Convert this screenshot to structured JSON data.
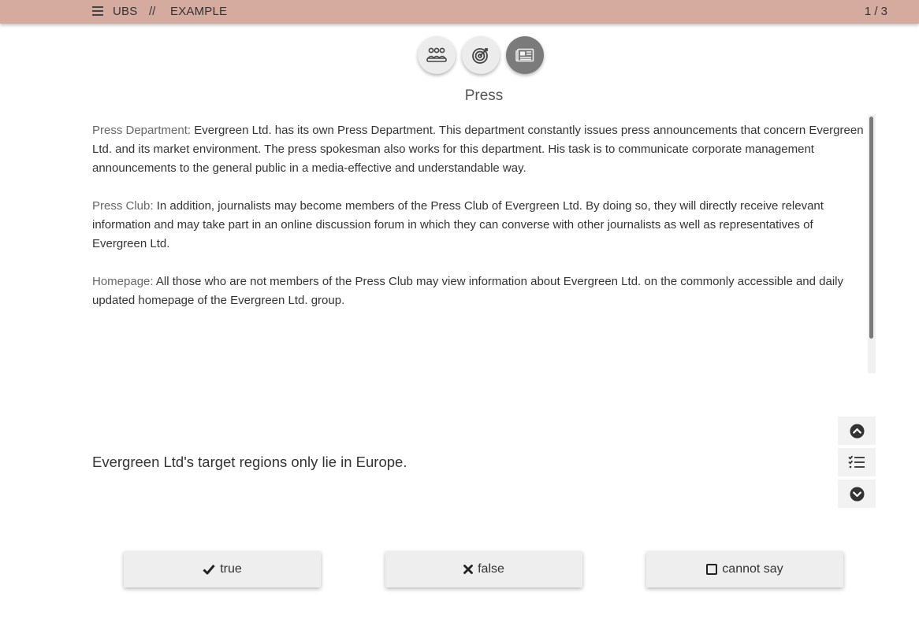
{
  "header": {
    "brand": "UBS",
    "separator": "//",
    "crumb": "EXAMPLE",
    "pager": "1 / 3"
  },
  "tabs": [
    {
      "icon": "team-icon"
    },
    {
      "icon": "target-icon"
    },
    {
      "icon": "newspaper-icon",
      "active": true
    }
  ],
  "section": {
    "title": "Press",
    "paragraphs": [
      {
        "term": "Press Department:",
        "text": " Evergreen Ltd. has its own Press Department. This department constantly issues press announcements that concern Evergreen Ltd. and its market environment. The press spokesman also works for this department. His task is to communicate corporate management announcements to the general public in a media-effective and understandable way."
      },
      {
        "term": "Press Club:",
        "text": " In addition, journalists may become members of the Press Club of Evergreen Ltd. By doing so, they will directly receive relevant information and may take part in an online discussion forum in which they can converse with other journalists as well as representatives of Evergreen Ltd."
      },
      {
        "term": "Homepage:",
        "text": " All those who are not members of the Press Club may view information about Evergreen Ltd. on the commonly accessible and daily updated homepage of the Evergreen Ltd. group."
      }
    ]
  },
  "question": {
    "statement": "Evergreen Ltd's target regions only lie in Europe."
  },
  "nav": {
    "up_icon": "chevron-circle-up-icon",
    "list_icon": "checklist-icon",
    "down_icon": "chevron-circle-down-icon"
  },
  "answers": {
    "true_label": "true",
    "false_label": "false",
    "cannot_label": "cannot say"
  },
  "colors": {
    "header_bg": "#d6ab9f",
    "active_tab": "#7b7b7b",
    "button_bg": "#eeeeee"
  }
}
